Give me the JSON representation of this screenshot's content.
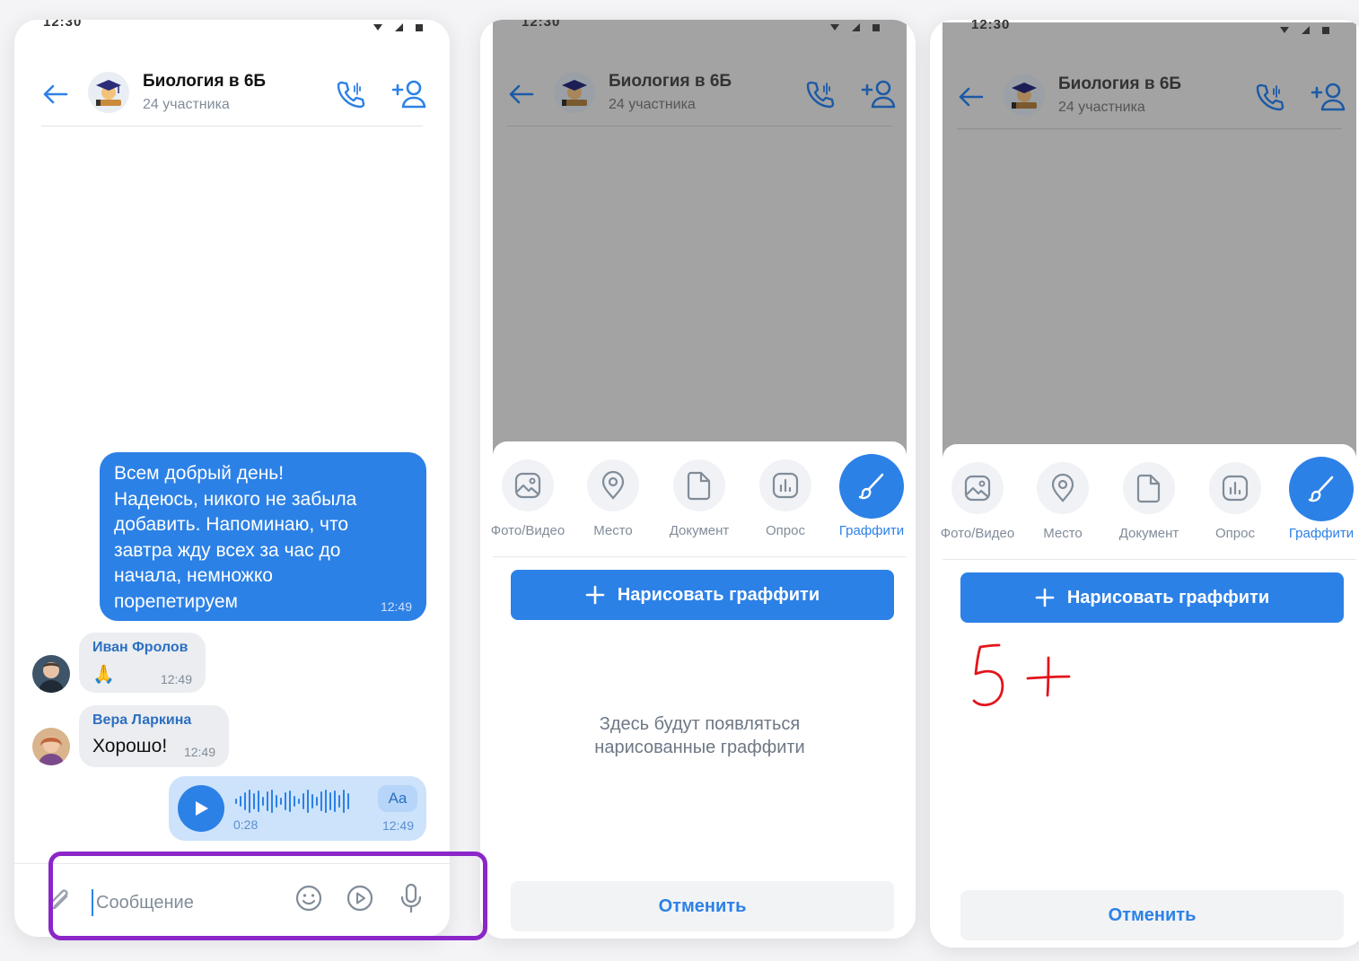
{
  "status": {
    "time": "12:30"
  },
  "chat": {
    "title": "Биология в 6Б",
    "members": "24 участника"
  },
  "messages": {
    "outgoing": {
      "text": "Всем добрый день!\nНадеюсь, никого не забыла\nдобавить. Напоминаю, что\nзавтра жду всех за час до\nначала, немножко\nпорепетируем",
      "time": "12:49"
    },
    "ivan": {
      "name": "Иван Фролов",
      "text": "🙏",
      "time": "12:49"
    },
    "vera": {
      "name": "Вера Ларкина",
      "text": "Хорошо!",
      "time": "12:49"
    },
    "voice": {
      "duration": "0:28",
      "time": "12:49",
      "transcribe": "Aa"
    }
  },
  "composer": {
    "placeholder": "Сообщение"
  },
  "attach_menu": {
    "items": [
      {
        "label": "Фото/Видео",
        "icon": "photo-icon"
      },
      {
        "label": "Место",
        "icon": "location-icon"
      },
      {
        "label": "Документ",
        "icon": "document-icon"
      },
      {
        "label": "Опрос",
        "icon": "poll-icon"
      },
      {
        "label": "Граффити",
        "icon": "brush-icon"
      }
    ],
    "draw_button": "Нарисовать граффити",
    "empty_note": "Здесь будут появляться\nнарисованные граффити",
    "cancel": "Отменить"
  },
  "colors": {
    "accent": "#2c81e6",
    "highlight": "#8b26c9",
    "graffiti": "#e3141c"
  }
}
